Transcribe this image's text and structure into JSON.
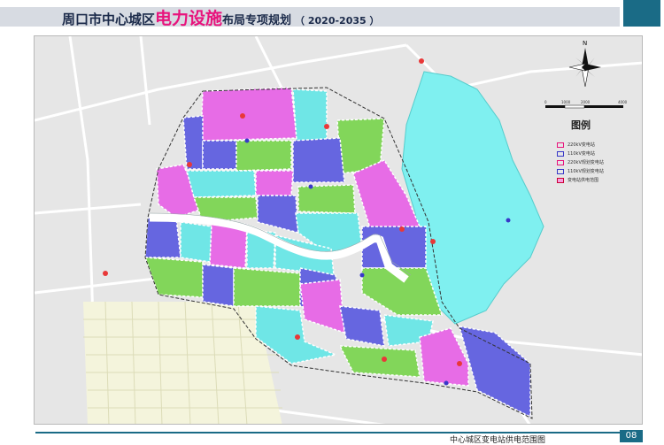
{
  "header": {
    "title_pre": "周口市中心城区",
    "title_highlight": "电力设施",
    "title_post": "布局专项规划",
    "title_years": "（ 2020-2035 ）"
  },
  "legend": {
    "title": "图例",
    "north_label": "N",
    "scale_ticks": [
      "0",
      "1000",
      "2000",
      "4000"
    ],
    "items": [
      {
        "label": "220kV变电站"
      },
      {
        "label": "110kV变电站"
      },
      {
        "label": "220kV规划变电站"
      },
      {
        "label": "110kV规划变电站"
      },
      {
        "label": "变电站供电范围"
      }
    ]
  },
  "footer": {
    "text": "中心城区变电站供电范围图",
    "page": "08"
  },
  "colors": {
    "magenta": "#e76ce6",
    "blue": "#6666e0",
    "green": "#82d65a",
    "cyan": "#6fe6e6",
    "water": "#7ff0f0",
    "accent": "#1a6b86"
  }
}
